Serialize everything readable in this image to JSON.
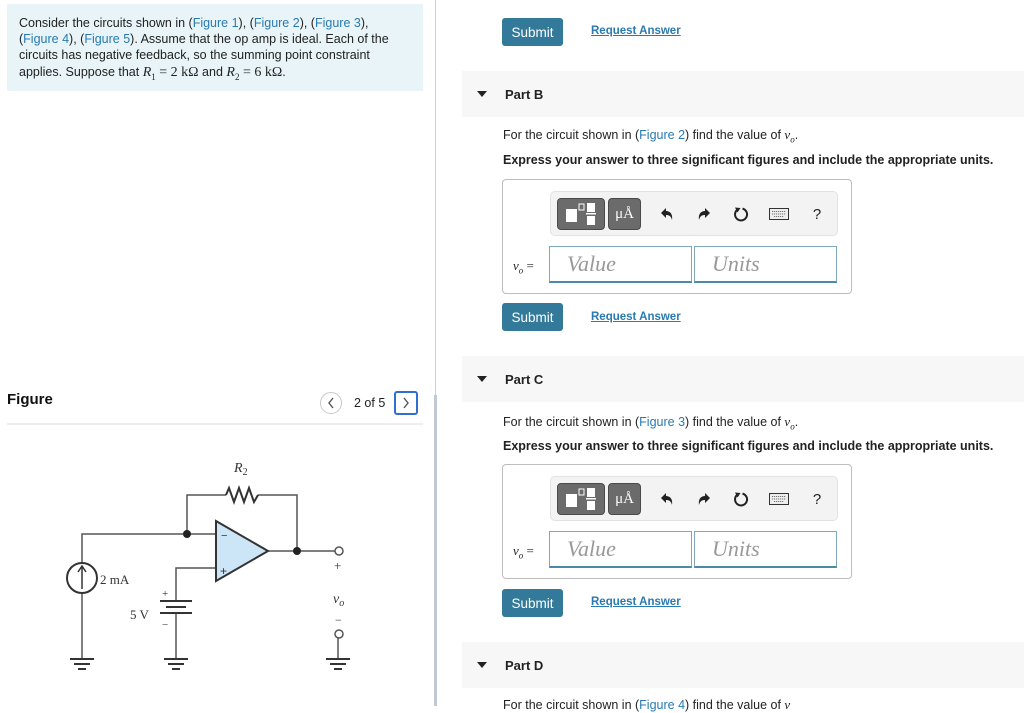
{
  "intro": {
    "text_before": "Consider the circuits shown in (",
    "figure_links": [
      "Figure 1",
      "Figure 2",
      "Figure 3",
      "Figure 4",
      "Figure 5"
    ],
    "text_after": "). Assume that the op amp is ideal. Each of the circuits has negative feedback, so the summing point constraint applies. Suppose that ",
    "r1_symbol": "R",
    "r1_sub": "1",
    "r1_value": " = 2 kΩ",
    "and": " and ",
    "r2_symbol": "R",
    "r2_sub": "2",
    "r2_value": " = 6 kΩ",
    "period": "."
  },
  "figure": {
    "title": "Figure",
    "page_counter": "2 of 5",
    "prev_icon": "chevron-left-icon",
    "next_icon": "chevron-right-icon",
    "circuit": {
      "resistor_label": "R",
      "resistor_sub": "2",
      "current_source_label": "2 mA",
      "voltage_source_label": "5 V",
      "output_label": "v",
      "output_sub": "o",
      "plus": "+",
      "minus": "−",
      "opamp_fill": "#cde6f7"
    }
  },
  "top_actions": {
    "submit_label": "Submit",
    "request_answer_label": "Request Answer"
  },
  "parts": [
    {
      "label": "Part B",
      "question_prefix": "For the circuit shown in (",
      "figure_link": "Figure 2",
      "question_suffix": ") find the value of ",
      "variable": "v",
      "variable_sub": "o",
      "instruction": "Express your answer to three significant figures and include the appropriate units.",
      "var_label": "v",
      "var_sub": "o",
      "equals": " =",
      "value_placeholder": "Value",
      "units_placeholder": "Units",
      "submit_label": "Submit",
      "request_answer_label": "Request Answer"
    },
    {
      "label": "Part C",
      "question_prefix": "For the circuit shown in (",
      "figure_link": "Figure 3",
      "question_suffix": ") find the value of ",
      "variable": "v",
      "variable_sub": "o",
      "instruction": "Express your answer to three significant figures and include the appropriate units.",
      "var_label": "v",
      "var_sub": "o",
      "equals": " =",
      "value_placeholder": "Value",
      "units_placeholder": "Units",
      "submit_label": "Submit",
      "request_answer_label": "Request Answer"
    },
    {
      "label": "Part D",
      "question_prefix": "For the circuit shown in (",
      "figure_link": "Figure 4",
      "question_suffix": ") find the value of ",
      "variable": "v"
    }
  ],
  "toolbar": {
    "templates_icon": "fraction-templates-icon",
    "units_label": "μÅ",
    "undo_icon": "undo-icon",
    "redo_icon": "redo-icon",
    "reset_icon": "reset-icon",
    "keyboard_icon": "keyboard-icon",
    "help_label": "?"
  },
  "colors": {
    "accent": "#337a9a",
    "link": "#2a7ab0",
    "intro_bg": "#e8f4f8",
    "part_header_bg": "#f7f7f7",
    "nav_focus": "#2f6fd0"
  }
}
